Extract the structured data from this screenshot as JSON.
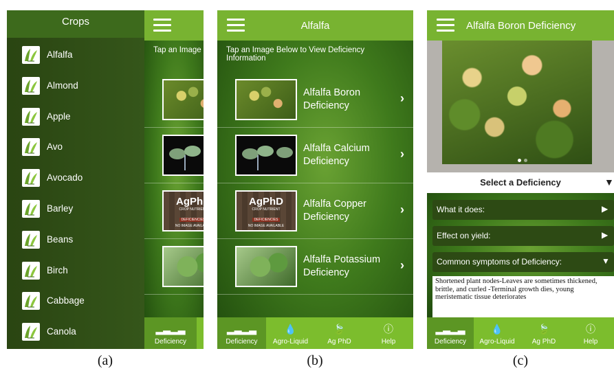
{
  "captions": [
    "(a)",
    "(b)",
    "(c)"
  ],
  "screen_a": {
    "menu_title": "Crops",
    "crops": [
      "Alfalfa",
      "Almond",
      "Apple",
      "Avo",
      "Avocado",
      "Barley",
      "Beans",
      "Birch",
      "Cabbage",
      "Canola"
    ],
    "tap_info": "Tap an Image Below to View Deficiency Information",
    "tab_deficiency": "Deficiency"
  },
  "screen_b": {
    "title": "Alfalfa",
    "tap_info": "Tap an Image Below to View Deficiency Information",
    "deficiencies": [
      "Alfalfa Boron Deficiency",
      "Alfalfa Calcium Deficiency",
      "Alfalfa Copper Deficiency",
      "Alfalfa Potassium Deficiency"
    ],
    "agphd_logo": "AgPhD",
    "agphd_line1": "CROP NUTRIENT",
    "agphd_line2": "DEFICIENCIES",
    "agphd_line3": "NO IMAGE AVAILABLE",
    "tabs": [
      "Deficiency",
      "Agro-Liquid",
      "Ag PhD",
      "Help"
    ]
  },
  "screen_c": {
    "title": "Alfalfa Boron Deficiency",
    "select_label": "Select a Deficiency",
    "sections": [
      {
        "label": "What it does:",
        "arrow": "▶"
      },
      {
        "label": "Effect on yield:",
        "arrow": "▶"
      },
      {
        "label": "Common symptoms of Deficiency:",
        "arrow": "▼"
      }
    ],
    "symptoms_text": "Shortened plant nodes-Leaves are sometimes thickened, brittle, and curled -Terminal growth dies, young meristematic tissue deteriorates",
    "tabs": [
      "Deficiency",
      "Agro-Liquid",
      "Ag PhD",
      "Help"
    ]
  },
  "colors": {
    "bar_green": "#78b331",
    "tab_green": "#7cbd2d",
    "active_tab": "#5c9624",
    "menu_dark": "#2d4a14"
  }
}
